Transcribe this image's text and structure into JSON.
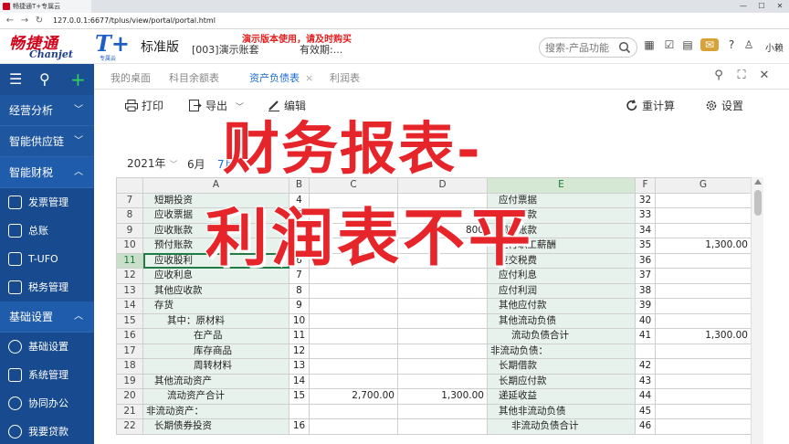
{
  "browser": {
    "tab_title": "畅捷通T+专属云",
    "url": "127.0.0.1:6677/tplus/view/portal/portal.html"
  },
  "header": {
    "logo_cn": "畅捷通",
    "logo_en": "Chanjet",
    "product": "T+",
    "product_sub": "专属云",
    "edition": "标准版",
    "account": "[003]演示账套",
    "demo_notice": "演示版本使用，请及时购买",
    "valid": "有效期:...",
    "search_placeholder": "搜索-产品功能",
    "username": "小赖"
  },
  "sidebar": {
    "groups": [
      {
        "label": "经营分析",
        "expanded": false
      },
      {
        "label": "智能供应链",
        "expanded": false
      },
      {
        "label": "智能财税",
        "expanded": true
      }
    ],
    "finance_items": [
      "发票管理",
      "总账",
      "T-UFO",
      "税务管理"
    ],
    "basic_group": {
      "label": "基础设置",
      "expanded": true
    },
    "basic_items": [
      "基础设置",
      "系统管理",
      "协同办公",
      "我要贷款"
    ]
  },
  "content_tabs": [
    {
      "label": "我的桌面",
      "active": false
    },
    {
      "label": "科目余额表",
      "active": false
    },
    {
      "label": "资产负债表",
      "active": true,
      "close": "×"
    },
    {
      "label": "利润表",
      "active": false
    }
  ],
  "toolbar": {
    "print": "打印",
    "export": "导出",
    "edit": "编辑",
    "recalc": "重计算",
    "settings": "设置"
  },
  "report": {
    "title_partial": "产",
    "year": "2021年",
    "months": [
      "6月",
      "7月"
    ],
    "selected_month": "7月"
  },
  "grid": {
    "columns": [
      "A",
      "B",
      "C",
      "D",
      "E",
      "F",
      "G"
    ],
    "selected_column": "E",
    "active_row": "11",
    "rows": [
      {
        "n": "7",
        "a": "短期投资",
        "a_ind": 1,
        "b": "4",
        "c": "",
        "d": "",
        "e": "应付票据",
        "e_ind": 1,
        "f": "32",
        "g": ""
      },
      {
        "n": "8",
        "a": "应收票据",
        "a_ind": 1,
        "b": "5",
        "c": "",
        "d": "",
        "e": "应付账款",
        "e_ind": 1,
        "f": "33",
        "g": ""
      },
      {
        "n": "9",
        "a": "应收账款",
        "a_ind": 1,
        "b": "",
        "c": "",
        "d": "800",
        "e": "预收账款",
        "e_ind": 1,
        "f": "34",
        "g": ""
      },
      {
        "n": "10",
        "a": "预付账款",
        "a_ind": 1,
        "b": "",
        "c": "",
        "d": "",
        "e": "应付职工薪酬",
        "e_ind": 1,
        "f": "35",
        "g": "1,300.00"
      },
      {
        "n": "11",
        "a": "应收股利",
        "a_ind": 1,
        "b": "6",
        "c": "",
        "d": "",
        "e": "应交税费",
        "e_ind": 1,
        "f": "36",
        "g": ""
      },
      {
        "n": "12",
        "a": "应收利息",
        "a_ind": 1,
        "b": "7",
        "c": "",
        "d": "",
        "e": "应付利息",
        "e_ind": 1,
        "f": "37",
        "g": ""
      },
      {
        "n": "13",
        "a": "其他应收款",
        "a_ind": 1,
        "b": "8",
        "c": "",
        "d": "",
        "e": "应付利润",
        "e_ind": 1,
        "f": "38",
        "g": ""
      },
      {
        "n": "14",
        "a": "存货",
        "a_ind": 1,
        "b": "9",
        "c": "",
        "d": "",
        "e": "其他应付款",
        "e_ind": 1,
        "f": "39",
        "g": ""
      },
      {
        "n": "15",
        "a": "其中：原材料",
        "a_ind": 2,
        "b": "10",
        "c": "",
        "d": "",
        "e": "其他流动负债",
        "e_ind": 1,
        "f": "40",
        "g": ""
      },
      {
        "n": "16",
        "a": "在产品",
        "a_ind": 3,
        "b": "11",
        "c": "",
        "d": "",
        "e": "流动负债合计",
        "e_ind": 2,
        "f": "41",
        "g": "1,300.00"
      },
      {
        "n": "17",
        "a": "库存商品",
        "a_ind": 3,
        "b": "12",
        "c": "",
        "d": "",
        "e": "非流动负债：",
        "e_ind": 0,
        "f": "",
        "g": ""
      },
      {
        "n": "18",
        "a": "周转材料",
        "a_ind": 3,
        "b": "13",
        "c": "",
        "d": "",
        "e": "长期借款",
        "e_ind": 1,
        "f": "42",
        "g": ""
      },
      {
        "n": "19",
        "a": "其他流动资产",
        "a_ind": 1,
        "b": "14",
        "c": "",
        "d": "",
        "e": "长期应付款",
        "e_ind": 1,
        "f": "43",
        "g": ""
      },
      {
        "n": "20",
        "a": "流动资产合计",
        "a_ind": 2,
        "b": "15",
        "c": "2,700.00",
        "d": "1,300.00",
        "e": "递延收益",
        "e_ind": 1,
        "f": "44",
        "g": ""
      },
      {
        "n": "21",
        "a": "非流动资产：",
        "a_ind": 0,
        "b": "",
        "c": "",
        "d": "",
        "e": "其他非流动负债",
        "e_ind": 1,
        "f": "45",
        "g": ""
      },
      {
        "n": "22",
        "a": "长期债券投资",
        "a_ind": 1,
        "b": "16",
        "c": "",
        "d": "",
        "e": "非流动负债合计",
        "e_ind": 2,
        "f": "46",
        "g": ""
      }
    ]
  },
  "overlay": {
    "line1": "财务报表-",
    "line2": "利润表不平"
  }
}
